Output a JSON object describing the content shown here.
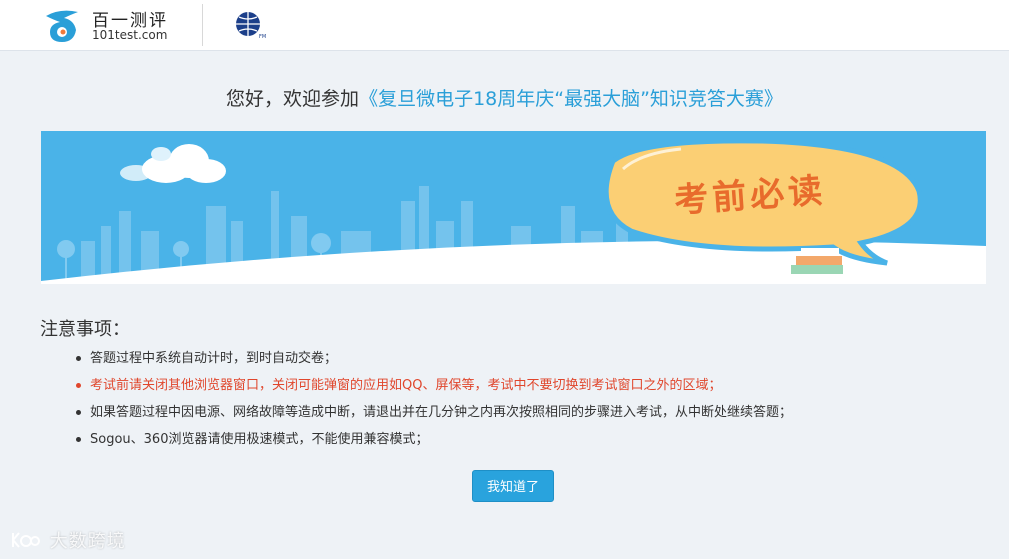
{
  "header": {
    "logo_name": "百一测评",
    "logo_domain": "101test.com",
    "partner_emblem_icon": "globe-emblem-icon"
  },
  "welcome": {
    "greeting": "您好，欢迎参加",
    "contest_name": "《复旦微电子18周年庆“最强大脑”知识竞答大赛》"
  },
  "banner": {
    "badge_text": "考前必读",
    "colors": {
      "sky": "#4ab3e8",
      "bubble": "#fbcf74",
      "bubble_text": "#e86b2c"
    }
  },
  "notes": {
    "title": "注意事项：",
    "items": [
      {
        "text": "答题过程中系统自动计时，到时自动交卷；",
        "warning": false
      },
      {
        "text": "考试前请关闭其他浏览器窗口，关闭可能弹窗的应用如QQ、屏保等，考试中不要切换到考试窗口之外的区域；",
        "warning": true
      },
      {
        "text": "如果答题过程中因电源、网络故障等造成中断，请退出并在几分钟之内再次按照相同的步骤进入考试，从中断处继续答题；",
        "warning": false
      },
      {
        "text": "Sogou、360浏览器请使用极速模式，不能使用兼容模式；",
        "warning": false
      }
    ]
  },
  "action": {
    "confirm_label": "我知道了"
  },
  "watermark": {
    "text": "大数跨境"
  },
  "colors": {
    "accent": "#29a3dd",
    "warning": "#e0462c",
    "background": "#eef2f6"
  }
}
